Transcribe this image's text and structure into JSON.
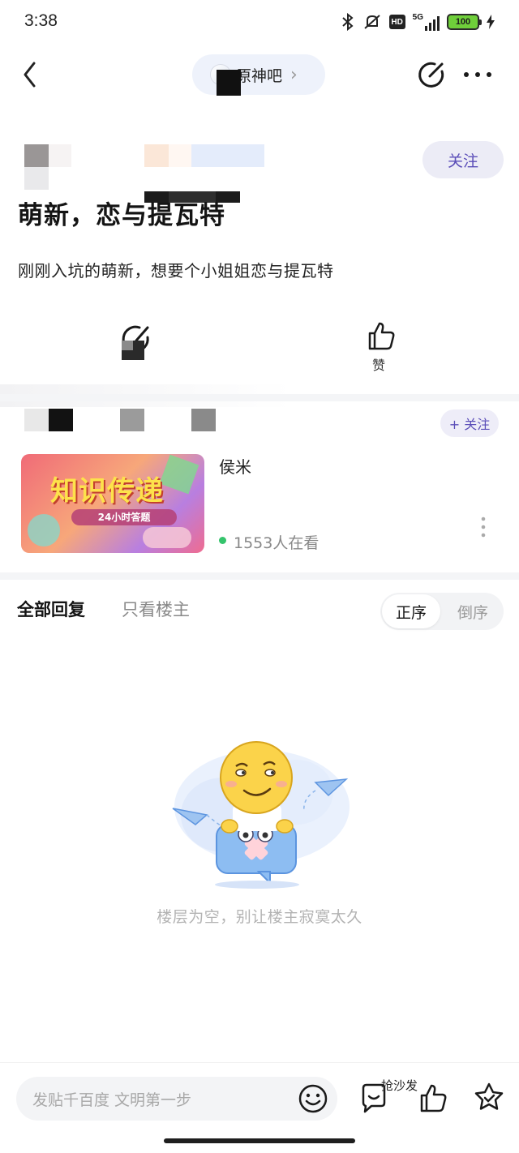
{
  "status_bar": {
    "time": "3:38",
    "network": "5G",
    "hd_label": "HD",
    "battery": "100"
  },
  "nav": {
    "forum_name": "原神吧",
    "forum_chevron": "›"
  },
  "post": {
    "follow_label": "关注",
    "title": "萌新，恋与提瓦特",
    "body": "刚刚入坑的萌新，想要个小姐姐恋与提瓦特",
    "like_label": "赞"
  },
  "live": {
    "follow_label": "+ 关注",
    "name": "侯米",
    "watching": "1553人在看",
    "banner_title": "知识传递",
    "banner_sub": "24小时答题"
  },
  "replies": {
    "tab_all": "全部回复",
    "tab_op": "只看楼主",
    "sort_asc": "正序",
    "sort_desc": "倒序",
    "empty_text": "楼层为空，别让楼主寂寞太久"
  },
  "bottom": {
    "input_placeholder": "发贴千百度 文明第一步",
    "sofa_label": "抢沙发"
  },
  "icons": {
    "back": "chevron-left-icon",
    "edit": "edit-icon",
    "more": "more-icon",
    "share": "share-icon",
    "like": "thumbs-up-icon",
    "emoji": "emoji-icon",
    "comment": "comment-icon",
    "star": "star-icon"
  },
  "colors": {
    "accent": "#5a4db8",
    "live_dot": "#35c46c"
  }
}
